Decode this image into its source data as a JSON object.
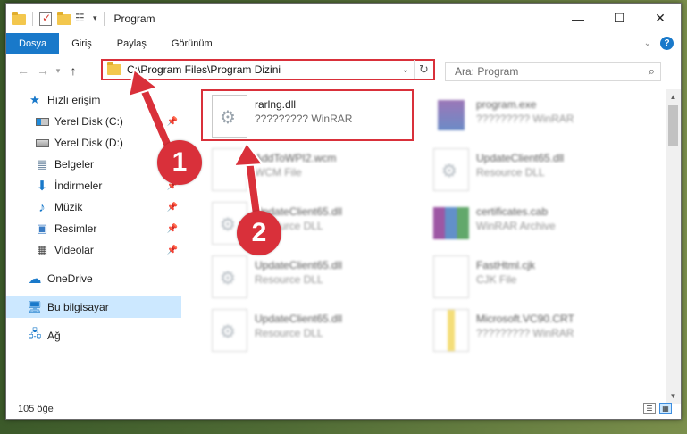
{
  "window": {
    "title": "Program",
    "controls": {
      "minimize": "—",
      "maximize": "☐",
      "close": "✕"
    }
  },
  "ribbon": {
    "tabs": [
      {
        "label": "Dosya",
        "active": true
      },
      {
        "label": "Giriş"
      },
      {
        "label": "Paylaş"
      },
      {
        "label": "Görünüm"
      }
    ],
    "help": "?"
  },
  "address": {
    "path": "C:\\Program Files\\Program Dizini",
    "search_placeholder": "Ara: Program"
  },
  "sidebar": {
    "items": [
      {
        "label": "Hızlı erişim",
        "icon": "star-icon"
      },
      {
        "label": "Yerel Disk (C:)",
        "icon": "disk-icon"
      },
      {
        "label": "Yerel Disk (D:)",
        "icon": "disk-icon"
      },
      {
        "label": "Belgeler",
        "icon": "document-icon"
      },
      {
        "label": "İndirmeler",
        "icon": "download-icon"
      },
      {
        "label": "Müzik",
        "icon": "music-icon"
      },
      {
        "label": "Resimler",
        "icon": "pictures-icon"
      },
      {
        "label": "Videolar",
        "icon": "video-icon"
      },
      {
        "label": "OneDrive",
        "icon": "cloud-icon"
      },
      {
        "label": "Bu bilgisayar",
        "icon": "computer-icon"
      },
      {
        "label": "Ağ",
        "icon": "network-icon"
      }
    ]
  },
  "files": [
    {
      "name": "rarlng.dll",
      "type": "????????? WinRAR"
    },
    {
      "name": "program.exe",
      "type": "????????? WinRAR"
    },
    {
      "name": "AddToWPI2.wcm",
      "type": "WCM File"
    },
    {
      "name": "UpdateClient65.dll",
      "type": "Resource DLL"
    },
    {
      "name": "UpdateClient65.dll",
      "type": "Resource DLL"
    },
    {
      "name": "certificates.cab",
      "type": "WinRAR Archive"
    },
    {
      "name": "UpdateClient65.dll",
      "type": "Resource DLL"
    },
    {
      "name": "FastHtml.cjk",
      "type": "CJK File"
    },
    {
      "name": "UpdateClient65.dll",
      "type": "Resource DLL"
    },
    {
      "name": "Microsoft.VC90.CRT",
      "type": "????????? WinRAR"
    }
  ],
  "status": {
    "count": "105 öğe"
  },
  "annotations": {
    "step1": "1",
    "step2": "2"
  },
  "colors": {
    "accent": "#1979ca",
    "highlight": "#d9303a",
    "selected": "#cce8ff"
  }
}
